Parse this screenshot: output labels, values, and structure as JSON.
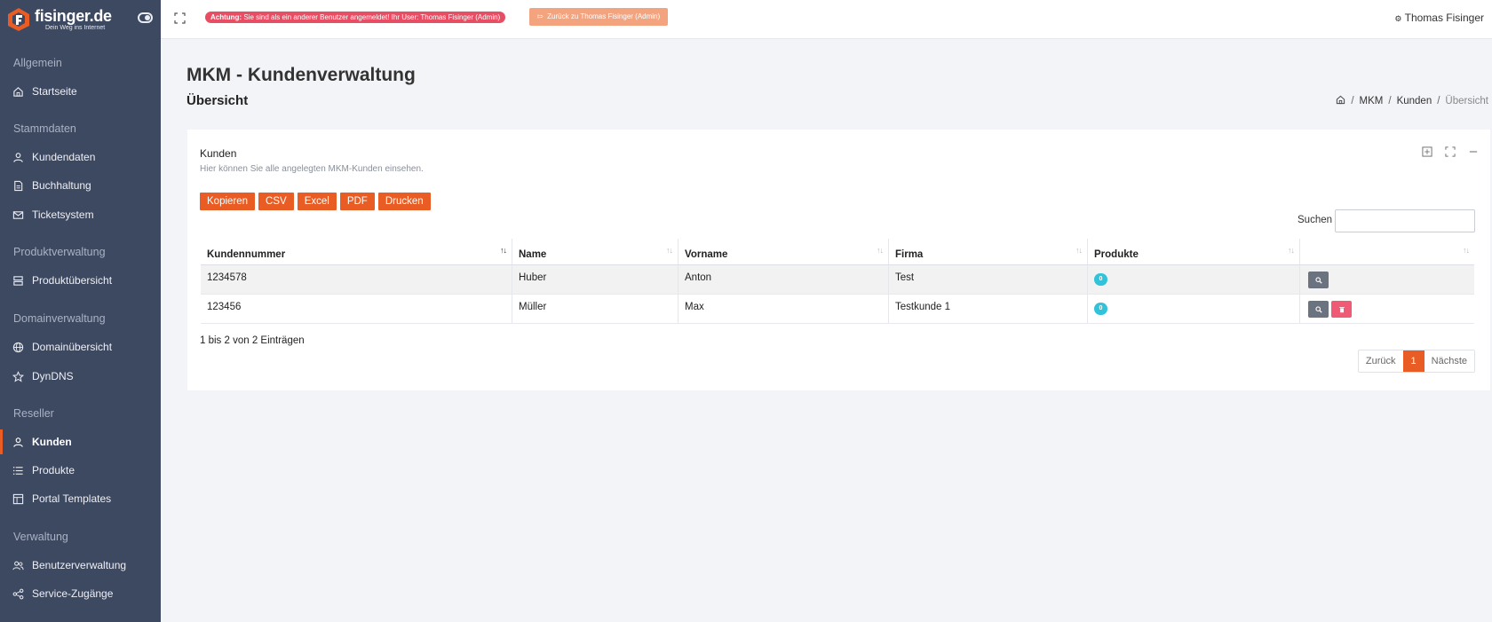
{
  "brand": {
    "name": "fisinger.de",
    "tagline": "Dein Weg ins Internet"
  },
  "sidebar": {
    "sections": [
      {
        "title": "Allgemein"
      },
      {
        "title": "Stammdaten"
      },
      {
        "title": "Produktverwaltung"
      },
      {
        "title": "Domainverwaltung"
      },
      {
        "title": "Reseller"
      },
      {
        "title": "Verwaltung"
      }
    ],
    "items": [
      {
        "label": "Startseite",
        "icon": "home-icon"
      },
      {
        "label": "Kundendaten",
        "icon": "user-icon"
      },
      {
        "label": "Buchhaltung",
        "icon": "document-icon"
      },
      {
        "label": "Ticketsystem",
        "icon": "mail-icon"
      },
      {
        "label": "Produktübersicht",
        "icon": "server-icon"
      },
      {
        "label": "Domainübersicht",
        "icon": "globe-icon"
      },
      {
        "label": "DynDNS",
        "icon": "star-icon"
      },
      {
        "label": "Kunden",
        "icon": "user-icon",
        "active": true
      },
      {
        "label": "Produkte",
        "icon": "list-icon"
      },
      {
        "label": "Portal Templates",
        "icon": "layout-icon"
      },
      {
        "label": "Benutzerverwaltung",
        "icon": "users-icon"
      },
      {
        "label": "Service-Zugänge",
        "icon": "share-icon"
      }
    ]
  },
  "topbar": {
    "warning_strong": "Achtung:",
    "warning_text": " Sie sind als ein anderer Benutzer angemeldet! Ihr User: Thomas Fisinger (Admin)",
    "back_button": "Zurück zu Thomas Fisinger (Admin)",
    "user": "Thomas Fisinger"
  },
  "page": {
    "title": "MKM - Kundenverwaltung",
    "subtitle": "Übersicht",
    "breadcrumb": [
      "MKM",
      "Kunden",
      "Übersicht"
    ]
  },
  "card": {
    "title": "Kunden",
    "description": "Hier können Sie alle angelegten MKM-Kunden einsehen.",
    "export_buttons": [
      "Kopieren",
      "CSV",
      "Excel",
      "PDF",
      "Drucken"
    ],
    "search_label": "Suchen",
    "search_value": "",
    "columns": [
      "Kundennummer",
      "Name",
      "Vorname",
      "Firma",
      "Produkte",
      ""
    ],
    "rows": [
      {
        "kundennummer": "1234578",
        "name": "Huber",
        "vorname": "Anton",
        "firma": "Test",
        "produkte": "0"
      },
      {
        "kundennummer": "123456",
        "name": "Müller",
        "vorname": "Max",
        "firma": "Testkunde 1",
        "produkte": "0"
      }
    ],
    "info": "1 bis 2 von 2 Einträgen",
    "pagination": {
      "prev": "Zurück",
      "current": "1",
      "next": "Nächste"
    }
  },
  "colors": {
    "sidebar": "#3d4861",
    "accent": "#e95d25",
    "warning": "#e84e63",
    "badge": "#30c3da",
    "delete": "#ef5b74"
  }
}
